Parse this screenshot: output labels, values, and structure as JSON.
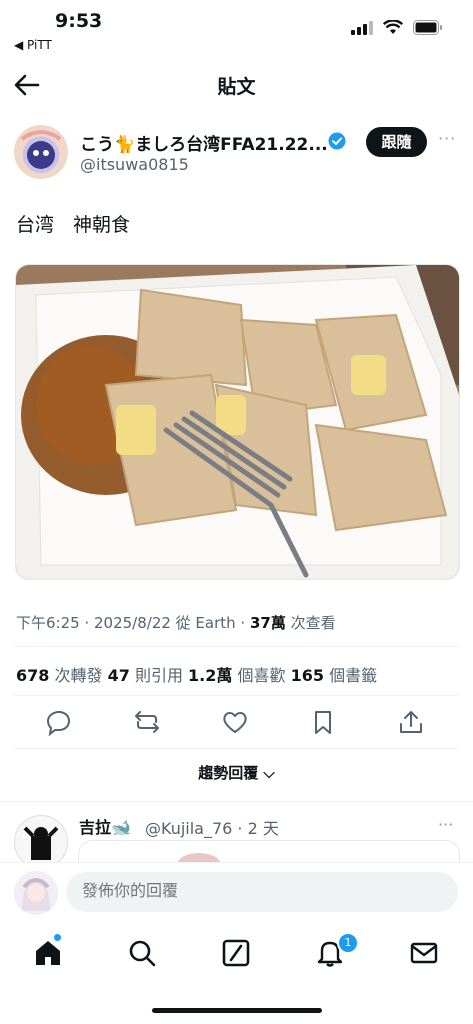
{
  "status_bar": {
    "time": "9:53",
    "back_app": "◀ PiTT"
  },
  "header": {
    "title": "貼文"
  },
  "author": {
    "display_name": "こう🐈ましろ台湾FFA21.22...",
    "handle": "@itsuwa0815",
    "follow_label": "跟隨",
    "more_label": "···"
  },
  "tweet": {
    "text": "台湾　神朝食",
    "meta": {
      "time": "下午6:25 · 2025/8/22 從 Earth · ",
      "views": "37萬",
      "views_label": " 次查看"
    },
    "stats": {
      "retweets": "678",
      "retweets_label": " 次轉發  ",
      "quotes": "47",
      "quotes_label": " 則引用  ",
      "likes": "1.2萬",
      "likes_label": " 個喜歡  ",
      "bookmarks": "165",
      "bookmarks_label": " 個書籤"
    }
  },
  "actions": [
    "reply-icon",
    "retweet-icon",
    "like-icon",
    "bookmark-icon",
    "share-icon"
  ],
  "trending_toggle": "趨勢回覆 ⌵",
  "reply": {
    "name": "吉拉🐋",
    "handle": "@Kujila_76 · 2 天",
    "more_label": "···"
  },
  "compose": {
    "placeholder": "發佈你的回覆"
  },
  "tabbar": {
    "notification_count": "1"
  },
  "colors": {
    "accent": "#1d9bf0",
    "text": "#0f1419",
    "muted": "#536471",
    "divider": "#eff3f4"
  }
}
